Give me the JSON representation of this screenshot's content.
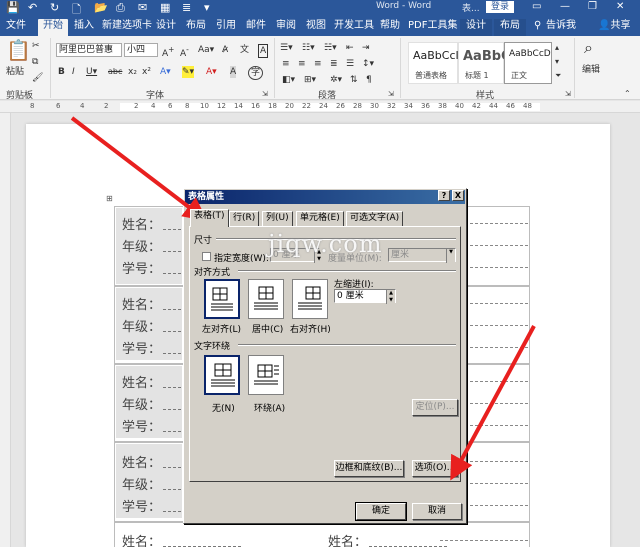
{
  "titlebar": {
    "doc_title": "Word - Word",
    "contextual_hint": "表...",
    "login": "登录",
    "minimize": "—",
    "restore": "❐",
    "close": "✕"
  },
  "tabs": [
    "文件",
    "开始",
    "插入",
    "新建选项卡",
    "设计",
    "布局",
    "引用",
    "邮件",
    "审阅",
    "视图",
    "开发工具",
    "帮助",
    "PDF工具集",
    "设计",
    "布局"
  ],
  "tell_me": "告诉我",
  "share": "共享",
  "ribbon": {
    "paste_label": "粘贴",
    "clipboard_group": "剪贴板",
    "font_name": "阿里巴巴普惠",
    "font_size": "小四",
    "font_group": "字体",
    "paragraph_group": "段落",
    "styles_group": "样式",
    "editing_label": "编辑",
    "styles": [
      {
        "sample": "AaBbCcI",
        "name": "普通表格"
      },
      {
        "sample": "AaBbC",
        "name": "标题 1"
      },
      {
        "sample": "AaBbCcD",
        "name": "正文"
      }
    ]
  },
  "ruler_numbers": [
    "8",
    "6",
    "4",
    "2",
    "2",
    "4",
    "6",
    "8",
    "10",
    "12",
    "14",
    "16",
    "18",
    "20",
    "22",
    "24",
    "26",
    "28",
    "30",
    "32",
    "34",
    "36",
    "38",
    "40",
    "42",
    "44",
    "46",
    "48"
  ],
  "doc_rows": [
    {
      "name": "姓名：",
      "grade": "年级：",
      "id": "学号："
    },
    {
      "name": "姓名：",
      "grade": "年级：",
      "id": "学号："
    },
    {
      "name": "姓名：",
      "grade": "年级：",
      "id": "学号："
    },
    {
      "name": "姓名：",
      "grade": "年级：",
      "id": "学号："
    },
    {
      "name": "姓名："
    }
  ],
  "right_name": "姓名：",
  "watermark": "jiqw.com",
  "dialog": {
    "title": "表格属性",
    "help_btn": "?",
    "close_btn": "X",
    "tabs": [
      "表格(T)",
      "行(R)",
      "列(U)",
      "单元格(E)",
      "可选文字(A)"
    ],
    "size_section": "尺寸",
    "specify_width": "指定宽度(W):",
    "width_value": "0 厘米",
    "measure_in": "度量单位(M):",
    "measure_value": "厘米",
    "alignment_section": "对齐方式",
    "align_options": [
      "左对齐(L)",
      "居中(C)",
      "右对齐(H)"
    ],
    "indent_label": "左缩进(I):",
    "indent_value": "0 厘米",
    "wrap_section": "文字环绕",
    "wrap_options": [
      "无(N)",
      "环绕(A)"
    ],
    "positioning_btn": "定位(P)...",
    "borders_btn": "边框和底纹(B)...",
    "options_btn": "选项(O)...",
    "ok_btn": "确定",
    "cancel_btn": "取消"
  },
  "colors": {
    "word_blue": "#2b579a",
    "dialog_gray": "#d4d0c8",
    "arrow_red": "#e8201f"
  }
}
